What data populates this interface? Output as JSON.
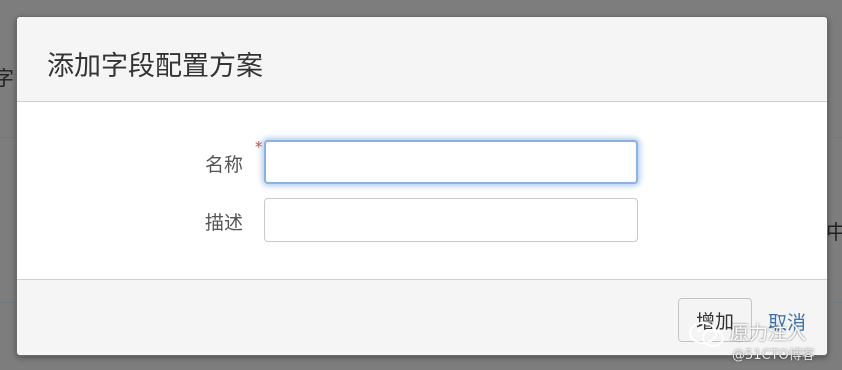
{
  "background": {
    "left_char": "字",
    "right_char": "中"
  },
  "dialog": {
    "title": "添加字段配置方案",
    "form": {
      "name_label": "名称",
      "name_required_mark": "*",
      "name_value": "",
      "description_label": "描述",
      "description_value": ""
    },
    "footer": {
      "add_label": "增加",
      "cancel_label": "取消"
    }
  },
  "watermark": {
    "name": "原力注入",
    "sub": "@51CTO博客"
  },
  "colors": {
    "overlay": "#7b7b7b",
    "required": "#d04437",
    "link": "#3b73af",
    "focus": "#8bb2e8"
  }
}
